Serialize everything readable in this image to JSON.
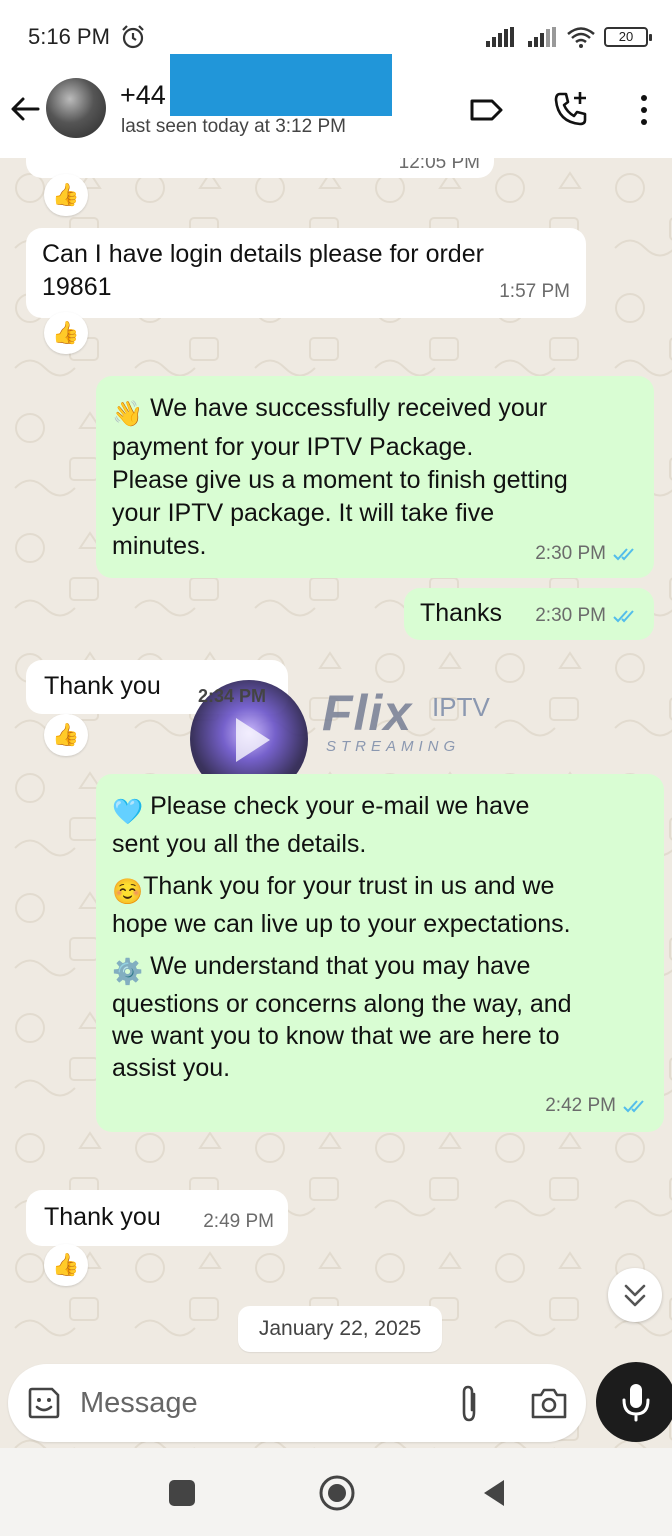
{
  "status_bar": {
    "time": "5:16 PM",
    "battery": "20"
  },
  "header": {
    "contact_name": "+44",
    "last_seen": "last seen today at 3:12 PM"
  },
  "messages": [
    {
      "id": "m0",
      "direction": "incoming",
      "time": "12:05 PM",
      "reaction": "👍"
    },
    {
      "id": "m1",
      "direction": "incoming",
      "lines": [
        "Can I have login details please for order",
        "19861"
      ],
      "time": "1:57 PM",
      "reaction": "👍"
    },
    {
      "id": "m2",
      "direction": "outgoing",
      "emoji": "👋",
      "lines": [
        "We have successfully received your",
        "payment for your IPTV Package.",
        "Please give us a moment to finish getting",
        "your IPTV package. It will take five",
        "minutes."
      ],
      "time": "2:30 PM",
      "status": "read"
    },
    {
      "id": "m3",
      "direction": "outgoing",
      "text": "Thanks",
      "time": "2:30 PM",
      "status": "read"
    },
    {
      "id": "m4",
      "direction": "incoming",
      "text": "Thank you",
      "time": "2:34 PM",
      "reaction": "👍"
    },
    {
      "id": "m5",
      "direction": "outgoing",
      "p1_emoji": "🩵",
      "p1": [
        "Please check your e-mail we have",
        "sent you all the details."
      ],
      "p2_emoji": "☺️",
      "p2": [
        "Thank you for your trust in us and we",
        "hope we can live up to your expectations."
      ],
      "p3_emoji": "⚙️",
      "p3": [
        "We understand that you may have",
        "questions or concerns along the way, and",
        "we want you to know that we are here to",
        "assist you."
      ],
      "time": "2:42 PM",
      "status": "read"
    },
    {
      "id": "m6",
      "direction": "incoming",
      "text": "Thank you",
      "time": "2:49 PM",
      "reaction": "👍"
    }
  ],
  "watermark": {
    "brand": "Flix",
    "suffix": "IPTV",
    "tagline": "STREAMING"
  },
  "date_chip": "January 22, 2025",
  "composer": {
    "placeholder": "Message"
  },
  "icons": [
    "back-arrow-icon",
    "label-icon",
    "add-call-icon",
    "more-vert-icon",
    "emoji-icon",
    "attach-icon",
    "camera-icon",
    "mic-icon",
    "chevron-double-down-icon"
  ],
  "colors": {
    "incoming_bubble": "#ffffff",
    "outgoing_bubble": "#d9fdd3",
    "chat_background": "#efeae2",
    "read_ticks": "#53bdeb",
    "redaction": "#2196d9"
  }
}
